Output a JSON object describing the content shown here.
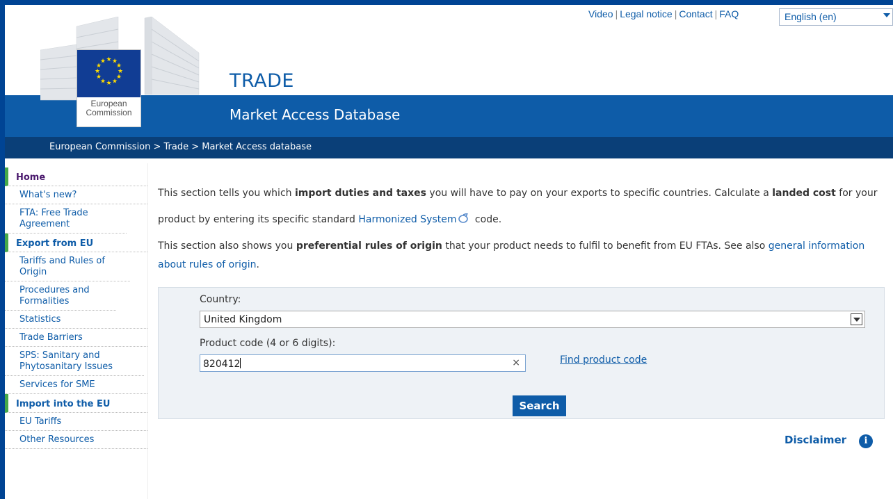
{
  "top_nav": {
    "video": "Video",
    "legal_notice": "Legal notice",
    "contact": "Contact",
    "faq": "FAQ",
    "separator": "|",
    "language": "English (en)"
  },
  "header": {
    "logo_text_line1": "European",
    "logo_text_line2": "Commission",
    "title": "TRADE",
    "subtitle": "Market Access Database"
  },
  "breadcrumb": "European Commission > Trade > Market Access database",
  "sidebar": {
    "home": "Home",
    "whats_new": "What's new?",
    "fta": "FTA: Free Trade Agreement",
    "export_section": "Export from EU",
    "tariffs": "Tariffs and Rules of Origin",
    "procedures": "Procedures and Formalities",
    "statistics": "Statistics",
    "trade_barriers": "Trade Barriers",
    "sps": "SPS: Sanitary and Phytosanitary Issues",
    "services_sme": "Services for SME",
    "import_section": "Import into the EU",
    "eu_tariffs": "EU Tariffs",
    "other_resources": "Other Resources"
  },
  "intro": {
    "p1_a": "This section tells you which ",
    "p1_b": "import duties and taxes",
    "p1_c": " you will have to pay on your exports to specific countries. Calculate a ",
    "p1_d": "landed cost",
    "p1_e": " for your product by entering its specific standard ",
    "p1_link": "Harmonized System",
    "p1_f": " code.",
    "p2_a": "This section also shows you ",
    "p2_b": "preferential rules of origin",
    "p2_c": " that your product needs to fulfil to benefit from EU FTAs. See also ",
    "p2_link": "general information about rules of origin",
    "p2_d": "."
  },
  "form": {
    "country_label": "Country:",
    "country_value": "United Kingdom",
    "code_label": "Product code (4 or 6 digits):",
    "code_value": "820412",
    "clear": "×",
    "find_link": "Find product code",
    "search": "Search"
  },
  "disclaimer": "Disclaimer",
  "info_glyph": "i",
  "colors": {
    "ec_blue": "#0e5ca8",
    "dark_blue": "#0a3f78",
    "green_accent": "#45a849",
    "home_purple": "#4b1a6e"
  }
}
